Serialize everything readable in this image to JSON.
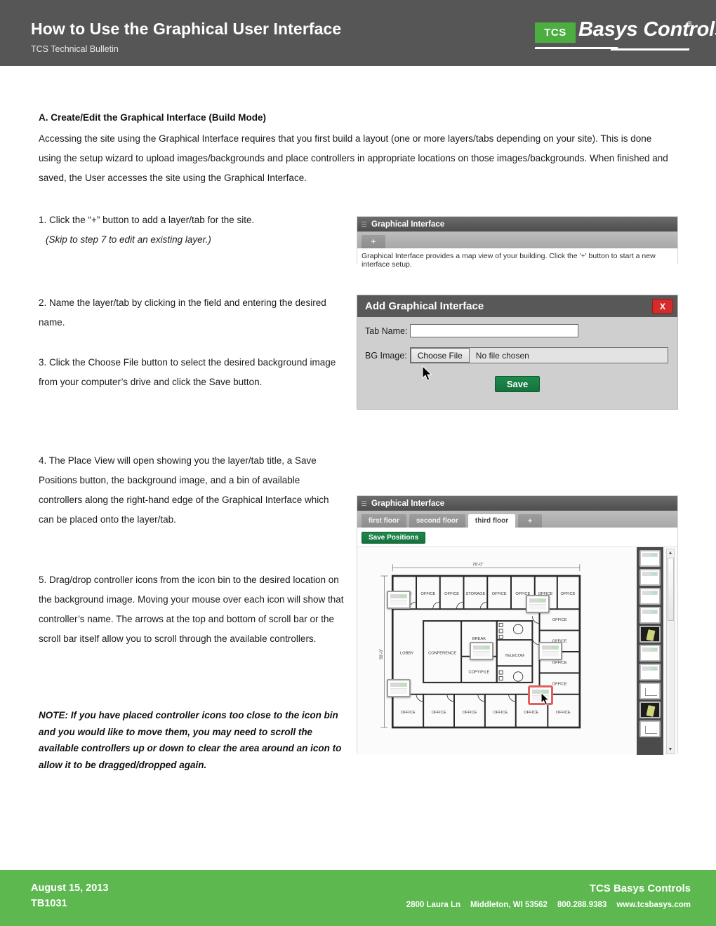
{
  "header": {
    "title": "How to Use the Graphical User Interface",
    "subtitle": "TCS Technical Bulletin",
    "logo": {
      "mark": "TCS",
      "name": "Basys Controls",
      "registered": "®",
      "green": "#4cae3f"
    },
    "bar_color": "#565656"
  },
  "body": {
    "section_heading": "A. Create/Edit the Graphical Interface (Build Mode)",
    "intro": "Accessing the site using the Graphical Interface requires that you first build a layout (one or more layers/tabs depending on your site). This is done using the setup wizard to upload images/backgrounds and place controllers in appropriate locations on those images/backgrounds. When finished and saved, the User accesses the site using the Graphical Interface.",
    "step1": "1. Click the “+” button to add a layer/tab for the site.",
    "step1_sub": "(Skip to step 7 to edit an existing layer.)",
    "step2": "2. Name the layer/tab by clicking in the field and entering the desired name.",
    "step3": "3. Click the Choose File button to select the desired background image from your computer’s drive and click the Save button.",
    "step4": "4. The Place View will open showing you the layer/tab title, a Save Positions button, the background image, and a bin of available controllers along the right-hand edge of the Graphical Interface which can be placed onto the layer/tab.",
    "step5": "5. Drag/drop controller icons from the icon bin to the desired location on the background image. Moving your mouse over each icon will show that controller’s name. The arrows at the top and bottom of scroll bar or the scroll bar itself allow you to scroll through the available controllers.",
    "note": "NOTE: If you have placed controller icons too close to the icon bin and you would like to move them, you may need to scroll the available controllers up or down to clear the area around an icon to allow it to be dragged/dropped again."
  },
  "shot_graphical_interface": {
    "panel_title": "Graphical Interface",
    "add_tab_label": "+",
    "description": "Graphical Interface provides a map view of your building. Click the '+' button to start a new interface setup."
  },
  "shot_add_dialog": {
    "title": "Add Graphical Interface",
    "close_label": "X",
    "tab_name_label": "Tab Name:",
    "tab_name_value": "",
    "tab_name_placeholder": "",
    "bg_image_label": "BG Image:",
    "choose_file_label": "Choose File",
    "file_status": "No file chosen",
    "save_label": "Save",
    "save_color": "#15713c",
    "close_color": "#d52b2b",
    "dialog_bg": "#cfcfcf"
  },
  "shot_place_view": {
    "panel_title": "Graphical Interface",
    "tabs": [
      {
        "label": "first floor",
        "active": false
      },
      {
        "label": "second floor",
        "active": false
      },
      {
        "label": "third floor",
        "active": true
      },
      {
        "label": "+",
        "active": false
      }
    ],
    "save_positions_label": "Save Positions",
    "floorplan": {
      "width_dim": "76'-0\"",
      "height_dim": "56'-0\"",
      "top_rooms": [
        "OFFICE",
        "OFFICE",
        "OFFICE",
        "STORAGE",
        "OFFICE",
        "OFFICE",
        "OFFICE",
        "OFFICE"
      ],
      "bottom_rooms": [
        "OFFICE",
        "OFFICE",
        "OFFICE",
        "OFFICE",
        "OFFICE",
        "OFFICE"
      ],
      "right_rooms": [
        "OFFICE",
        "OFFICE",
        "OFFICE",
        "OFFICE"
      ],
      "center_rooms": [
        "LOBBY",
        "CONFERENCE",
        "BREAK",
        "COPY/FILE",
        "TELECOM"
      ]
    },
    "placed_icon_count": 6,
    "bin_items": [
      "controller",
      "controller",
      "controller",
      "controller",
      "sensor-dark",
      "controller",
      "controller",
      "diagram",
      "sensor-dark",
      "diagram"
    ],
    "scroll_up_arrow": "▲",
    "scroll_down_arrow": "▼"
  },
  "footer": {
    "date": "August 15, 2013",
    "doc_number": "TB1031",
    "company": "TCS Basys Controls",
    "address": "2800 Laura Ln",
    "city_state_zip": "Middleton, WI 53562",
    "phone": "800.288.9383",
    "website": "www.tcsbasys.com",
    "bg_color": "#5cb84f"
  }
}
